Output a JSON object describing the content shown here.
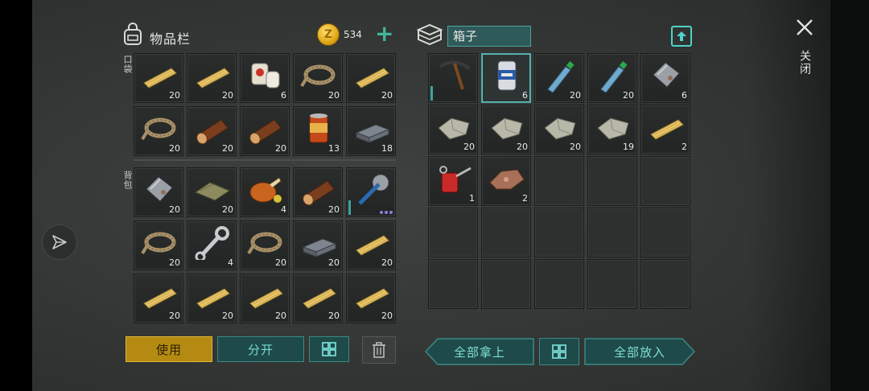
{
  "inventory": {
    "title": "物品栏",
    "coins": "534",
    "pocket_label": "口袋",
    "backpack_label": "背包",
    "pocket": [
      {
        "item": "plank",
        "qty": "20"
      },
      {
        "item": "plank",
        "qty": "20"
      },
      {
        "item": "bandage",
        "qty": "6"
      },
      {
        "item": "rope",
        "qty": "20"
      },
      {
        "item": "plank",
        "qty": "20"
      },
      {
        "item": "rope",
        "qty": "20"
      },
      {
        "item": "log",
        "qty": "20"
      },
      {
        "item": "log",
        "qty": "20"
      },
      {
        "item": "canned-food",
        "qty": "13"
      },
      {
        "item": "iron-ingot",
        "qty": "18"
      }
    ],
    "backpack": [
      {
        "item": "metal-plate",
        "qty": "20"
      },
      {
        "item": "cloth",
        "qty": "20"
      },
      {
        "item": "roast-chicken",
        "qty": "4"
      },
      {
        "item": "log",
        "qty": "20"
      },
      {
        "item": "saw-tool",
        "qty": ""
      },
      {
        "item": "rope",
        "qty": "20"
      },
      {
        "item": "wrench",
        "qty": "4"
      },
      {
        "item": "rope",
        "qty": "20"
      },
      {
        "item": "iron-ingot",
        "qty": "20"
      },
      {
        "item": "plank",
        "qty": "20"
      },
      {
        "item": "plank",
        "qty": "20"
      },
      {
        "item": "plank",
        "qty": "20"
      },
      {
        "item": "plank",
        "qty": "20"
      },
      {
        "item": "plank",
        "qty": "20"
      },
      {
        "item": "plank",
        "qty": "20"
      }
    ]
  },
  "box": {
    "name": "箱子",
    "slots": [
      {
        "item": "pickaxe",
        "qty": ""
      },
      {
        "item": "beer-can",
        "qty": "6"
      },
      {
        "item": "water-bottle",
        "qty": "20"
      },
      {
        "item": "water-bottle",
        "qty": "20"
      },
      {
        "item": "metal-plate",
        "qty": "6"
      },
      {
        "item": "stone",
        "qty": "20"
      },
      {
        "item": "stone",
        "qty": "20"
      },
      {
        "item": "stone",
        "qty": "20"
      },
      {
        "item": "stone",
        "qty": "19"
      },
      {
        "item": "plank",
        "qty": "2"
      },
      {
        "item": "oil-can",
        "qty": "1"
      },
      {
        "item": "copper-ore",
        "qty": "2"
      },
      {
        "item": "",
        "qty": ""
      },
      {
        "item": "",
        "qty": ""
      },
      {
        "item": "",
        "qty": ""
      },
      {
        "item": "",
        "qty": ""
      },
      {
        "item": "",
        "qty": ""
      },
      {
        "item": "",
        "qty": ""
      },
      {
        "item": "",
        "qty": ""
      },
      {
        "item": "",
        "qty": ""
      },
      {
        "item": "",
        "qty": ""
      },
      {
        "item": "",
        "qty": ""
      },
      {
        "item": "",
        "qty": ""
      },
      {
        "item": "",
        "qty": ""
      },
      {
        "item": "",
        "qty": ""
      }
    ]
  },
  "buttons": {
    "use": "使用",
    "split": "分开",
    "take_all": "全部拿上",
    "put_all": "全部放入",
    "close": "关闭"
  },
  "colors": {
    "accent": "#4aa3a0",
    "use_button": "#b48a12",
    "coin": "#e0a818"
  }
}
